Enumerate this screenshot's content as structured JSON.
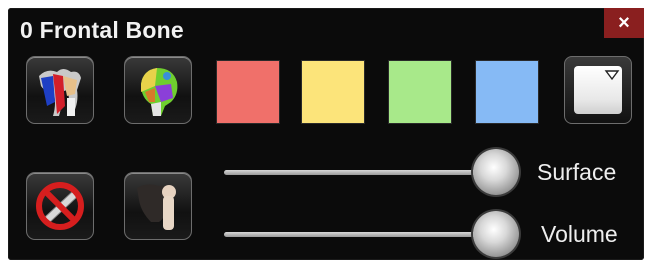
{
  "panel": {
    "title": "0 Frontal Bone",
    "close_label": "×"
  },
  "tools": {
    "row1": [
      "skeleton-view-icon",
      "segmented-bone-icon"
    ],
    "row2": [
      "hide-icon",
      "shaded-bone-icon"
    ]
  },
  "swatches": [
    {
      "name": "red",
      "color": "#F0706A"
    },
    {
      "name": "yellow",
      "color": "#FCE47A"
    },
    {
      "name": "green",
      "color": "#A8E98A"
    },
    {
      "name": "blue",
      "color": "#86BAF5"
    }
  ],
  "picker": {
    "color": "#FFFFFF"
  },
  "sliders": [
    {
      "label": "Surface",
      "value": 1.0
    },
    {
      "label": "Volume",
      "value": 1.0
    }
  ]
}
